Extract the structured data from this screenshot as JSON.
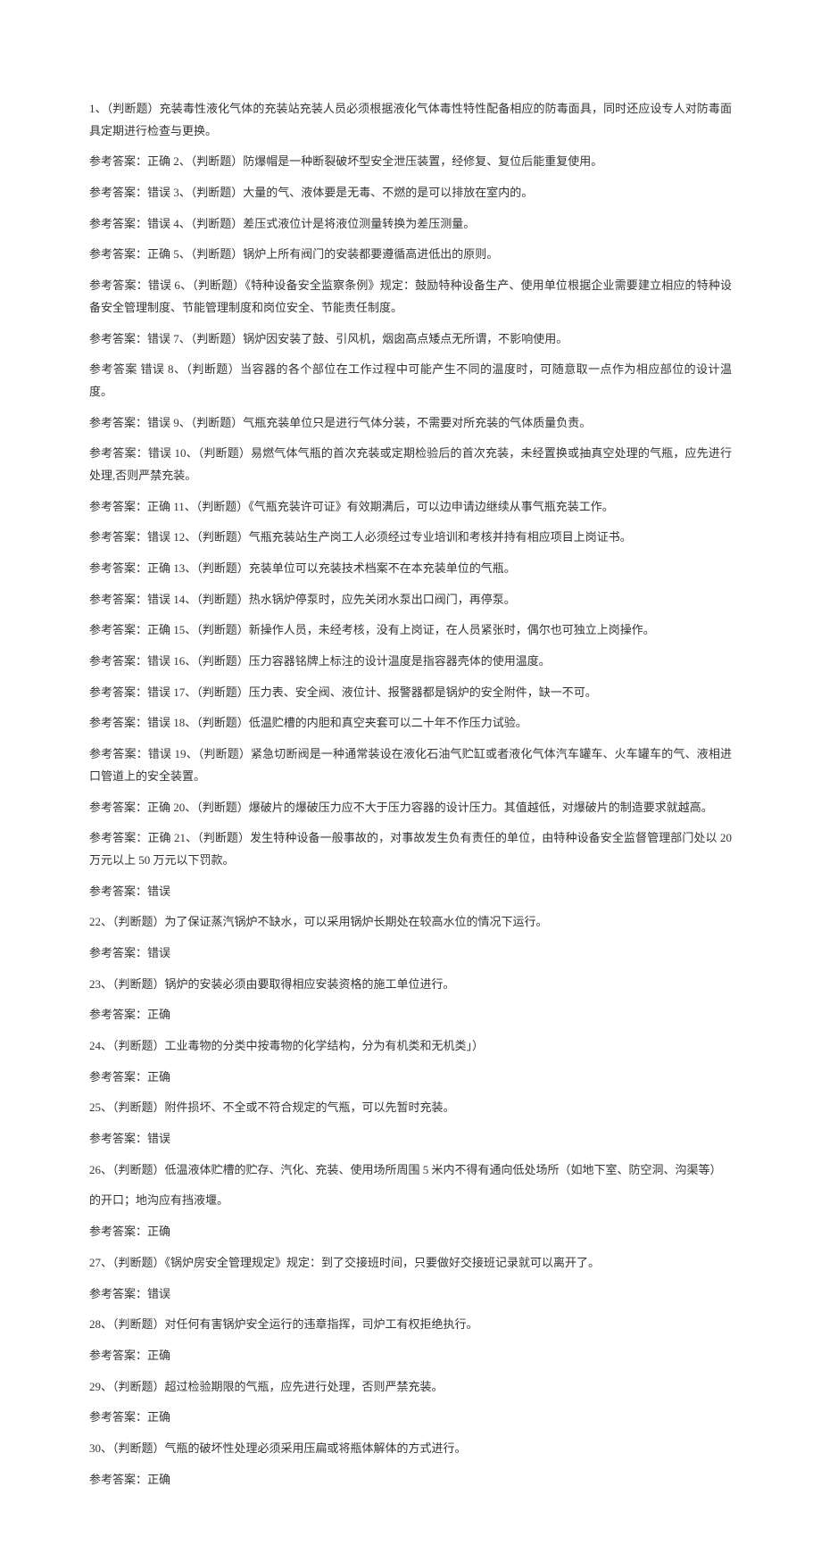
{
  "lines": [
    "1、（判断题）充装毒性液化气体的充装站充装人员必须根据液化气体毒性特性配备相应的防毒面具，同时还应设专人对防毒面具定期进行检查与更换。",
    "参考答案：正确 2、（判断题）防爆帽是一种断裂破坏型安全泄压装置，经修复、复位后能重复使用。",
    "参考答案：错误 3、（判断题）大量的气、液体要是无毒、不燃的是可以排放在室内的。",
    "参考答案：错误 4、（判断题）差压式液位计是将液位测量转换为差压测量。",
    "参考答案：正确 5、（判断题）锅炉上所有阀门的安装都要遵循高进低出的原则。",
    "参考答案：错误 6、（判断题）《特种设备安全监察条例》规定：鼓励特种设备生产、使用单位根据企业需要建立相应的特种设备安全管理制度、节能管理制度和岗位安全、节能责任制度。",
    "参考答案：错误 7、（判断题）锅炉因安装了鼓、引风机，烟囱高点矮点无所谓，不影响使用。",
    "参考答案 错误 8、（判断题）当容器的各个部位在工作过程中可能产生不同的温度时，可随意取一点作为相应部位的设计温度。",
    "参考答案：错误 9、（判断题）气瓶充装单位只是进行气体分装，不需要对所充装的气体质量负责。",
    "参考答案：错误 10、（判断题）易燃气体气瓶的首次充装或定期检验后的首次充装，未经置换或抽真空处理的气瓶，应先进行处理,否则严禁充装。",
    "参考答案：正确 11、（判断题）《气瓶充装许可证》有效期满后，可以边申请边继续从事气瓶充装工作。",
    "参考答案：错误 12、（判断题）气瓶充装站生产岗工人必须经过专业培训和考核并持有相应项目上岗证书。",
    "参考答案：正确 13、（判断题）充装单位可以充装技术档案不在本充装单位的气瓶。",
    "参考答案：错误 14、（判断题）热水锅炉停泵时，应先关闭水泵出口阀门，再停泵。",
    "参考答案：正确 15、（判断题）新操作人员，未经考核，没有上岗证，在人员紧张时，偶尔也可独立上岗操作。",
    "参考答案：错误 16、（判断题）压力容器铭牌上标注的设计温度是指容器壳体的使用温度。",
    "参考答案：错误 17、（判断题）压力表、安全阀、液位计、报警器都是锅炉的安全附件，缺一不可。",
    "参考答案：错误 18、（判断题）低温贮槽的内胆和真空夹套可以二十年不作压力试验。",
    "参考答案：错误 19、（判断题）紧急切断阀是一种通常装设在液化石油气贮缸或者液化气体汽车罐车、火车罐车的气、液相进口管道上的安全装置。",
    "参考答案：正确 20、（判断题）爆破片的爆破压力应不大于压力容器的设计压力。其值越低，对爆破片的制造要求就越高。",
    "参考答案：正确 21、（判断题）发生特种设备一般事故的，对事故发生负有责任的单位，由特种设备安全监督管理部门处以 20万元以上 50 万元以下罚款。",
    "参考答案：错误",
    "22、（判断题）为了保证蒸汽锅炉不缺水，可以采用锅炉长期处在较高水位的情况下运行。",
    "参考答案：错误",
    "23、（判断题）锅炉的安装必须由要取得相应安装资格的施工单位进行。",
    "参考答案：正确",
    "24、（判断题）工业毒物的分类中按毒物的化学结构，分为有机类和无机类」）",
    "参考答案：正确",
    "25、（判断题）附件损坏、不全或不符合规定的气瓶，可以先暂时充装。",
    "参考答案：错误",
    "26、（判断题）低温液体贮槽的贮存、汽化、充装、使用场所周围 5 米内不得有通向低处场所（如地下室、防空洞、沟渠等）",
    "的开口；地沟应有挡液堰。",
    "参考答案：正确",
    "27、（判断题）《锅炉房安全管理规定》规定：到了交接班时间，只要做好交接班记录就可以离开了。",
    "参考答案：错误",
    "28、（判断题）对任何有害锅炉安全运行的违章指挥，司炉工有权拒绝执行。",
    "参考答案：正确",
    "29、（判断题）超过检验期限的气瓶，应先进行处理，否则严禁充装。",
    "参考答案：正确",
    "30、（判断题）气瓶的破坏性处理必须采用压扁或将瓶体解体的方式进行。",
    "参考答案：正确"
  ]
}
